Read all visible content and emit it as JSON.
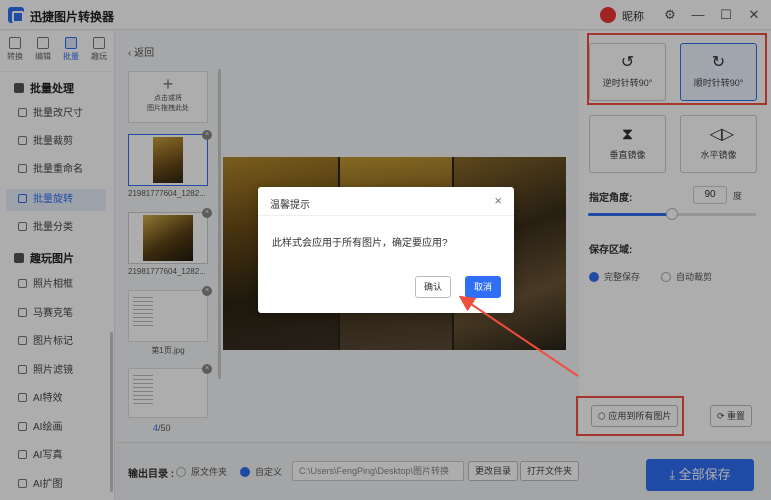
{
  "app": {
    "title": "迅捷图片转换器",
    "nickname": "昵称"
  },
  "window_controls": {
    "settings": "⚙",
    "minimize": "—",
    "maximize": "☐",
    "close": "✕"
  },
  "toolbar": [
    {
      "label": "转换",
      "icon": "convert-icon"
    },
    {
      "label": "编辑",
      "icon": "edit-icon"
    },
    {
      "label": "批量",
      "icon": "batch-icon",
      "active": true
    },
    {
      "label": "趣玩",
      "icon": "fun-icon"
    }
  ],
  "sidebar": {
    "group1": "批量处理",
    "group1_items": [
      "批量改尺寸",
      "批量裁剪",
      "批量重命名",
      "批量旋转",
      "批量分类"
    ],
    "group2": "趣玩图片",
    "group2_items": [
      "照片相框",
      "马赛克笔",
      "图片标记",
      "照片滤镜",
      "AI特效",
      "AI绘画",
      "AI写真",
      "AI扩图"
    ],
    "active": "批量旋转"
  },
  "main": {
    "back": "返回",
    "add_line1": "点击或将",
    "add_line2": "图片拖拽此处",
    "thumbs": [
      {
        "name": "21981777604_1282..."
      },
      {
        "name": "21981777604_1282..."
      },
      {
        "name": "第1页.jpg"
      }
    ],
    "page_current": "4",
    "page_total": "/50"
  },
  "right": {
    "rotate_ccw": "逆时针转90°",
    "rotate_cw": "顺时针转90°",
    "flip_v": "垂直镜像",
    "flip_h": "水平镜像",
    "angle_label": "指定角度:",
    "angle_value": "90",
    "angle_unit": "度",
    "angle_fraction": 0.5,
    "save_area_label": "保存区域:",
    "save_full": "完整保存",
    "save_crop": "自动裁剪",
    "apply_all": "应用到所有图片",
    "reset": "重置"
  },
  "bottom": {
    "output_label": "输出目录 :",
    "opt_original": "原文件夹",
    "opt_custom": "自定义",
    "path": "C:\\Users\\FengPing\\Desktop\\图片转换",
    "change_dir": "更改目录",
    "open_folder": "打开文件夹",
    "save_all": "全部保存"
  },
  "dialog": {
    "title": "温馨提示",
    "message": "此样式会应用于所有图片，确定要应用?",
    "ok": "确认",
    "cancel": "取消"
  },
  "colors": {
    "accent": "#2f6ff5",
    "annotation": "#f04e3e"
  }
}
